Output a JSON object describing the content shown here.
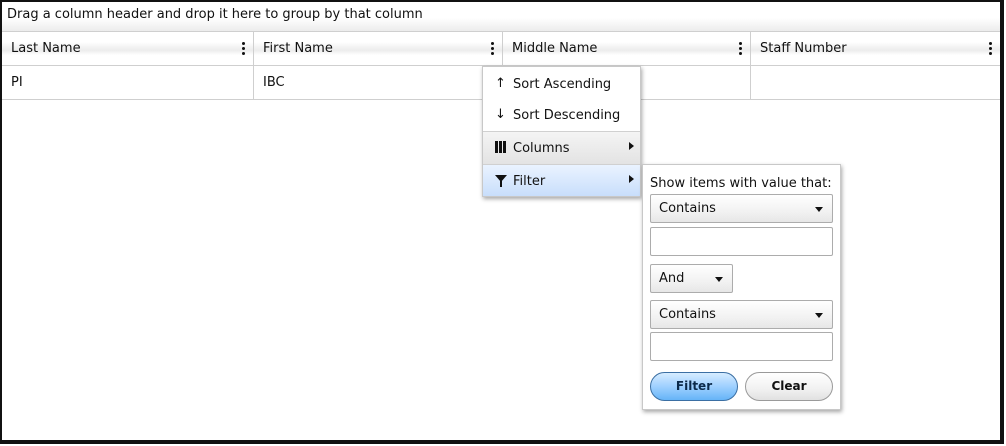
{
  "group_panel": {
    "hint": "Drag a column header and drop it here to group by that column"
  },
  "columns": [
    {
      "label": "Last Name"
    },
    {
      "label": "First Name"
    },
    {
      "label": "Middle Name"
    },
    {
      "label": "Staff Number"
    }
  ],
  "rows": [
    {
      "cells": [
        "PI",
        "IBC",
        "",
        ""
      ]
    }
  ],
  "column_menu": {
    "items": [
      {
        "label": "Sort Ascending",
        "icon": "arrow-up-icon"
      },
      {
        "label": "Sort Descending",
        "icon": "arrow-down-icon"
      },
      {
        "label": "Columns",
        "icon": "columns-icon"
      },
      {
        "label": "Filter",
        "icon": "filter-icon"
      }
    ]
  },
  "filter_panel": {
    "title": "Show items with value that:",
    "operator1": "Contains",
    "value1": "",
    "logic": "And",
    "operator2": "Contains",
    "value2": "",
    "filter_label": "Filter",
    "clear_label": "Clear"
  },
  "colors": {
    "highlight": "#c8defb",
    "filter_button": "#9fd0ff",
    "border": "#cfcfcf"
  }
}
